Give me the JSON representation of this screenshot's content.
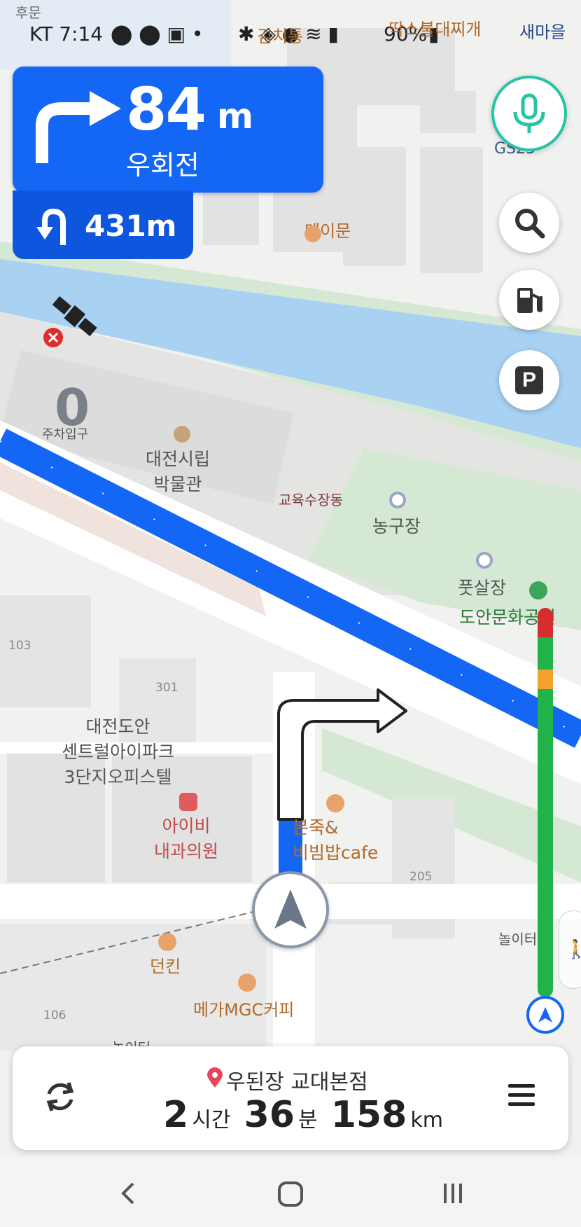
{
  "status_bar": {
    "carrier_time": "KT 7:14",
    "battery": "90%",
    "top_left_label": "후문",
    "top_poi_1": "김치통",
    "top_poi_2": "딱스불대찌개",
    "top_poi_3": "새마을",
    "top_poi_4": "GS25"
  },
  "guidance": {
    "distance": "84",
    "unit": "m",
    "action": "우회전",
    "next_distance": "431m",
    "next_icon": "u-turn-icon",
    "current_icon": "turn-right-icon"
  },
  "speed_limit": "0",
  "map_labels": {
    "meimun": "메이문",
    "entrance": "주차입구",
    "museum_line1": "대전시립",
    "museum_line2": "박물관",
    "gyoyuk": "교육수장동",
    "basketball": "농구장",
    "futsal": "풋살장",
    "park": "도안문화공원",
    "office_line1": "대전도안",
    "office_line2": "센트럴아이파크",
    "office_line3": "3단지오피스텔",
    "clinic_line1": "아이비",
    "clinic_line2": "내과의원",
    "bonjuk_line1": "본죽&",
    "bonjuk_line2": "비빔밥cafe",
    "dunkin": "던킨",
    "mega": "메가MGC커피",
    "playground1": "놀이터",
    "playground2": "놀이터",
    "n103": "103",
    "n301": "301",
    "n205": "205",
    "n106": "106"
  },
  "controls": {
    "mic_icon": "microphone-icon",
    "search_icon": "search-icon",
    "gas_icon": "gas-station-icon",
    "parking_icon": "parking-icon",
    "parking_label": "P"
  },
  "bottom_panel": {
    "destination": "우된장 교대본점",
    "hours": "2",
    "hours_unit": "시간",
    "minutes": "36",
    "minutes_unit": "분",
    "distance": "158",
    "distance_unit": "km"
  },
  "colors": {
    "route_blue": "#1466f5",
    "traffic_green": "#22b24c",
    "traffic_red": "#d62e2e",
    "traffic_orange": "#f2a12c",
    "river": "#a9d1f2",
    "park_green": "#d5e8d4"
  }
}
